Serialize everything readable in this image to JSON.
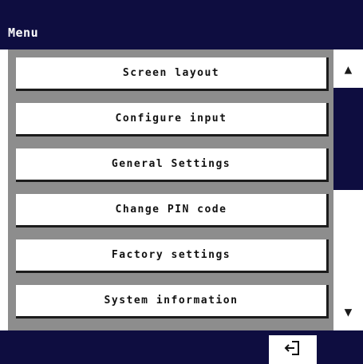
{
  "header": {
    "title": "Menu"
  },
  "menu": {
    "items": [
      {
        "label": "Screen layout"
      },
      {
        "label": "Configure input"
      },
      {
        "label": "General Settings"
      },
      {
        "label": "Change PIN code"
      },
      {
        "label": "Factory settings"
      },
      {
        "label": "System information"
      }
    ]
  },
  "scrollbar": {
    "up_icon": "triangle-up-icon",
    "down_icon": "triangle-down-icon",
    "visible_fraction": 0.5
  },
  "footer": {
    "exit_icon": "exit-arrow-icon"
  },
  "colors": {
    "bar": "#0e0d40",
    "panel": "#8d8d8d",
    "button": "#ffffff",
    "button_shadow": "#1c1c1c"
  }
}
